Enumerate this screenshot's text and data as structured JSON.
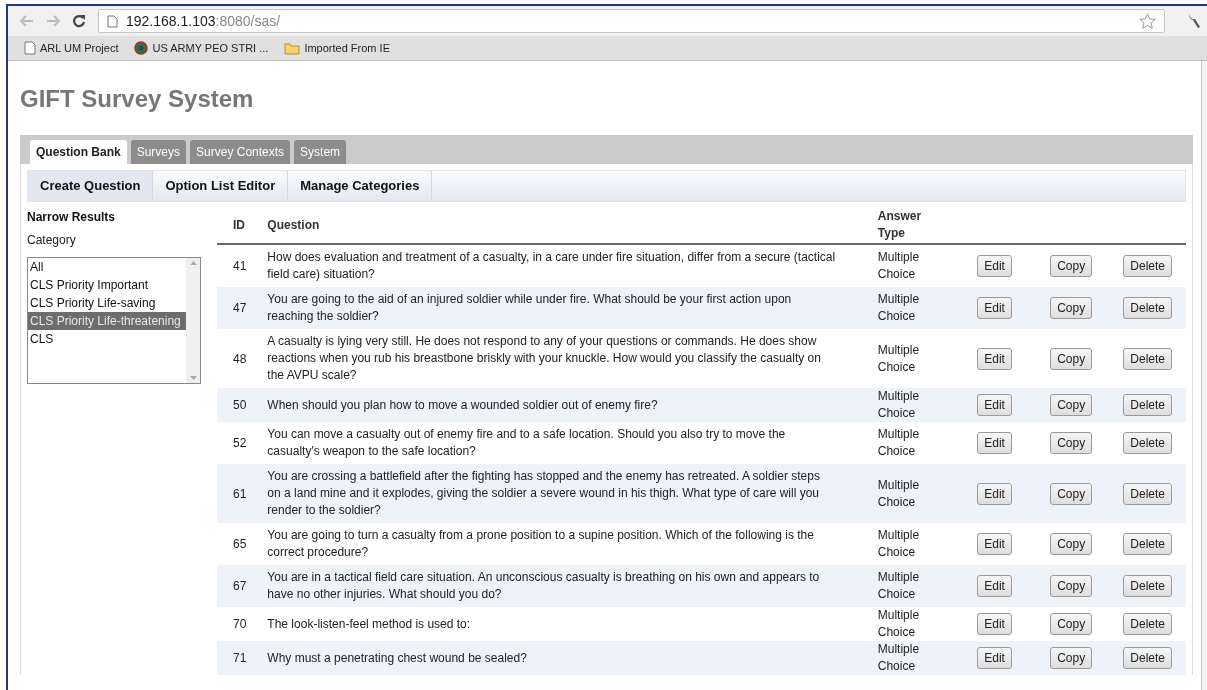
{
  "browser": {
    "address_host": "192.168.1.103",
    "address_rest": ":8080/sas/",
    "bookmarks": [
      {
        "kind": "page",
        "label": "ARL UM Project"
      },
      {
        "kind": "site",
        "label": "US ARMY PEO STRI ..."
      },
      {
        "kind": "folder",
        "label": "Imported From IE"
      }
    ]
  },
  "page_title": "GIFT Survey System",
  "tabs": [
    {
      "label": "Question Bank",
      "selected": true
    },
    {
      "label": "Surveys",
      "selected": false
    },
    {
      "label": "Survey Contexts",
      "selected": false
    },
    {
      "label": "System",
      "selected": false
    }
  ],
  "subnav": [
    {
      "label": "Create Question",
      "selected": true
    },
    {
      "label": "Option List Editor",
      "selected": false
    },
    {
      "label": "Manage Categories",
      "selected": false
    }
  ],
  "filter": {
    "heading": "Narrow Results",
    "label": "Category",
    "items": [
      {
        "label": "All",
        "selected": false
      },
      {
        "label": "CLS Priority Important",
        "selected": false
      },
      {
        "label": "CLS Priority Life-saving",
        "selected": false
      },
      {
        "label": "CLS Priority Life-threatening",
        "selected": true
      },
      {
        "label": "CLS",
        "selected": false
      }
    ]
  },
  "table": {
    "columns": [
      "ID",
      "Question",
      "Answer Type"
    ],
    "rows": [
      {
        "id": "41",
        "question": "How does evaluation and treatment of a casualty, in a care under fire situation, differ from a secure (tactical field care) situation?",
        "answer_type": "Multiple Choice",
        "actions": [
          "Edit",
          "Copy",
          "Delete"
        ]
      },
      {
        "id": "47",
        "question": "You are going to the aid of an injured soldier while under fire. What should be your first action upon reaching the soldier?",
        "answer_type": "Multiple Choice",
        "actions": [
          "Edit",
          "Copy",
          "Delete"
        ]
      },
      {
        "id": "48",
        "question": "A casualty is lying very still. He does not respond to any of your questions or commands. He does show reactions when you rub his breastbone briskly with your knuckle. How would you classify the casualty on the AVPU scale?",
        "answer_type": "Multiple Choice",
        "actions": [
          "Edit",
          "Copy",
          "Delete"
        ]
      },
      {
        "id": "50",
        "question": "When should you plan how to move a wounded soldier out of enemy fire?",
        "answer_type": "Multiple Choice",
        "actions": [
          "Edit",
          "Copy",
          "Delete"
        ]
      },
      {
        "id": "52",
        "question": "You can move a casualty out of enemy fire and to a safe location. Should you also try to move the casualty's weapon to the safe location?",
        "answer_type": "Multiple Choice",
        "actions": [
          "Edit",
          "Copy",
          "Delete"
        ]
      },
      {
        "id": "61",
        "question": "You are crossing a battlefield after the fighting has stopped and the enemy has retreated. A soldier steps on a land mine and it explodes, giving the soldier a severe wound in his thigh. What type of care will you render to the soldier?",
        "answer_type": "Multiple Choice",
        "actions": [
          "Edit",
          "Copy",
          "Delete"
        ]
      },
      {
        "id": "65",
        "question": "You are going to turn a casualty from a prone position to a supine position. Which of the following is the correct procedure?",
        "answer_type": "Multiple Choice",
        "actions": [
          "Edit",
          "Copy",
          "Delete"
        ]
      },
      {
        "id": "67",
        "question": "You are in a tactical field care situation. An unconscious casualty is breathing on his own and appears to have no other injuries. What should you do?",
        "answer_type": "Multiple Choice",
        "actions": [
          "Edit",
          "Copy",
          "Delete"
        ]
      },
      {
        "id": "70",
        "question": "The look-listen-feel method is used to:",
        "answer_type": "Multiple Choice",
        "actions": [
          "Edit",
          "Copy",
          "Delete"
        ]
      },
      {
        "id": "71",
        "question": "Why must a penetrating chest wound be sealed?",
        "answer_type": "Multiple Choice",
        "actions": [
          "Edit",
          "Copy",
          "Delete"
        ]
      }
    ]
  }
}
